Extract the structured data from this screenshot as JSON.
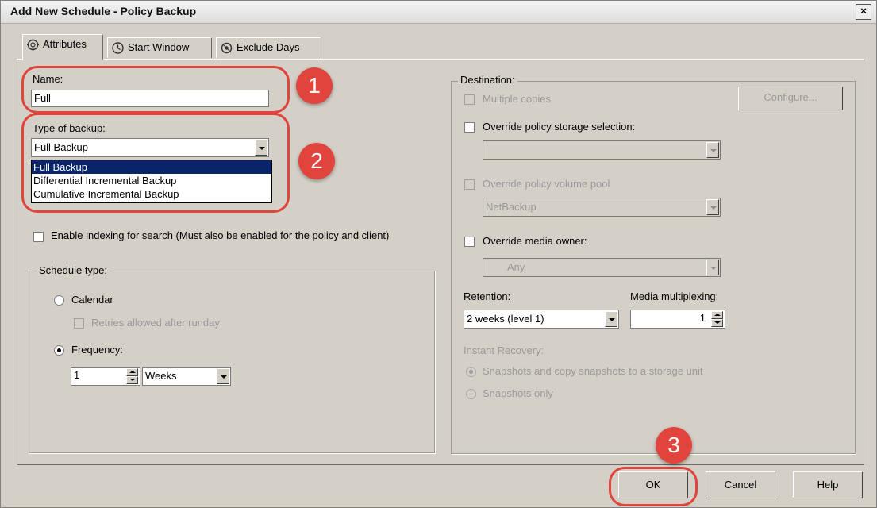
{
  "window": {
    "title": "Add New Schedule - Policy Backup",
    "close_glyph": "×"
  },
  "tabs": [
    {
      "label": "Attributes",
      "icon": "gear-icon"
    },
    {
      "label": "Start Window",
      "icon": "clock-icon"
    },
    {
      "label": "Exclude Days",
      "icon": "calendar-gear-icon"
    }
  ],
  "name": {
    "label": "Name:",
    "value": "Full"
  },
  "backup_type": {
    "label": "Type of backup:",
    "value": "Full Backup",
    "options": [
      "Full Backup",
      "Differential Incremental Backup",
      "Cumulative Incremental Backup"
    ]
  },
  "indexing": {
    "label": "Enable indexing for search (Must also be enabled for the policy and client)"
  },
  "schedule_type": {
    "label": "Schedule type:",
    "calendar": "Calendar",
    "retries": "Retries allowed after runday",
    "frequency": "Frequency:",
    "freq_value": "1",
    "freq_unit": "Weeks"
  },
  "destination": {
    "label": "Destination:",
    "multiple_copies": "Multiple copies",
    "configure": "Configure...",
    "override_storage": "Override policy storage selection:",
    "storage_value": "",
    "override_pool": "Override policy volume pool",
    "pool_value": "NetBackup",
    "override_owner": "Override media owner:",
    "owner_value": "Any",
    "retention_label": "Retention:",
    "retention_value": "2 weeks (level 1)",
    "multiplexing_label": "Media multiplexing:",
    "multiplexing_value": "1",
    "instant_recovery": "Instant Recovery:",
    "ir_option1": "Snapshots and copy snapshots to a storage unit",
    "ir_option2": "Snapshots only"
  },
  "buttons": {
    "ok": "OK",
    "cancel": "Cancel",
    "help": "Help"
  },
  "callouts": [
    "1",
    "2",
    "3"
  ],
  "colors": {
    "callout": "#e0443c",
    "selection": "#0a246a",
    "dialog": "#d4d0c8"
  }
}
